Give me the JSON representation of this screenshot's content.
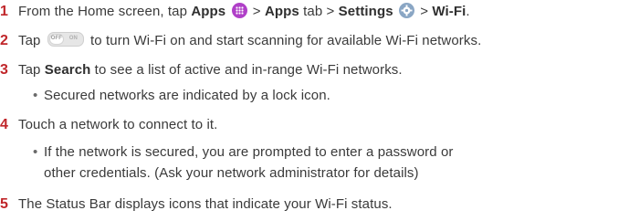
{
  "steps": [
    {
      "number": "1",
      "parts": {
        "t1": "From the Home screen, tap ",
        "apps": "Apps",
        "t2": " > ",
        "apps_tab": "Apps",
        "t3": " tab > ",
        "settings": "Settings",
        "t4": " > ",
        "wifi": "Wi-Fi",
        "t5": "."
      }
    },
    {
      "number": "2",
      "parts": {
        "t1": "Tap ",
        "toggle_off": "OFF",
        "toggle_on": "ON",
        "t2": " to turn Wi-Fi on and start scanning for available Wi-Fi networks."
      }
    },
    {
      "number": "3",
      "parts": {
        "t1": "Tap ",
        "search": "Search",
        "t2": " to see a list of active and in-range Wi-Fi networks."
      },
      "bullets": [
        "Secured networks are indicated by a lock icon."
      ]
    },
    {
      "number": "4",
      "text": "Touch a network to connect to it.",
      "bullets": [
        "If the network is secured, you are prompted to enter a password or",
        "other credentials. (Ask your network administrator for details)"
      ]
    },
    {
      "number": "5",
      "text": "The Status Bar displays icons that indicate your Wi-Fi status."
    }
  ],
  "bullet_glyph": "•",
  "icons": {
    "apps": "apps-grid-icon",
    "settings": "settings-gear-icon",
    "toggle": "wifi-toggle-off-icon"
  },
  "colors": {
    "step_number": "#c0262a",
    "text": "#3a3a3a",
    "apps_icon": "#b040c8",
    "settings_icon": "#8aa6c4"
  }
}
